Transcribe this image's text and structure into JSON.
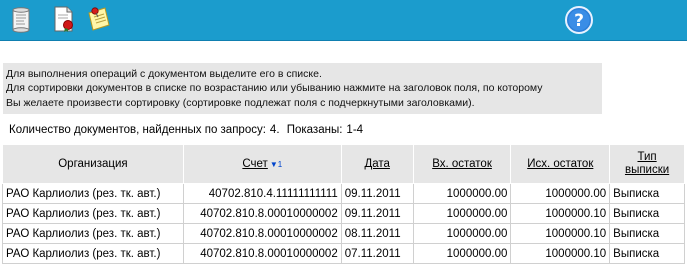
{
  "toolbar": {
    "icons": [
      "document-scroll-icon",
      "document-certificate-icon",
      "note-pin-icon"
    ],
    "help": "?"
  },
  "info": {
    "lines": [
      "Для выполнения операций с документом выделите его в списке.",
      "Для сортировки документов в списке по возрастанию или убыванию нажмите на заголовок поля, по которому",
      "Вы желаете произвести сортировку (сортировке подлежат поля с подчеркнутыми заголовками)."
    ]
  },
  "summary": {
    "found_label": "Количество  документов, найденных по запросу:",
    "found_count": "4.",
    "shown_label": "Показаны:",
    "shown_range": "1-4"
  },
  "table": {
    "headers": {
      "org": "Организация",
      "account": "Счет",
      "sort_arrow": "▼1",
      "date": "Дата",
      "in_balance": "Вх. остаток",
      "out_balance": "Исх. остаток",
      "type_line1": "Тип",
      "type_line2": "выписки"
    },
    "rows": [
      {
        "org": "РАО Карлиолиз (рез. тк. авт.)",
        "account": "40702.810.4.11111111111",
        "date": "09.11.2011",
        "in": "1000000.00",
        "out": "1000000.00",
        "type": "Выписка"
      },
      {
        "org": "РАО Карлиолиз (рез. тк. авт.)",
        "account": "40702.810.8.00010000002",
        "date": "09.11.2011",
        "in": "1000000.00",
        "out": "1000000.10",
        "type": "Выписка"
      },
      {
        "org": "РАО Карлиолиз (рез. тк. авт.)",
        "account": "40702.810.8.00010000002",
        "date": "08.11.2011",
        "in": "1000000.00",
        "out": "1000000.10",
        "type": "Выписка"
      },
      {
        "org": "РАО Карлиолиз (рез. тк. авт.)",
        "account": "40702.810.8.00010000002",
        "date": "07.11.2011",
        "in": "1000000.00",
        "out": "1000000.10",
        "type": "Выписка"
      }
    ]
  }
}
